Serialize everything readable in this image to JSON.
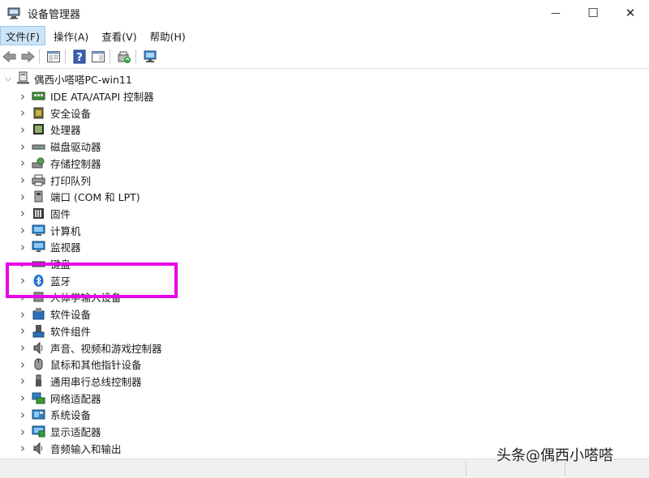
{
  "window": {
    "title": "设备管理器",
    "minimize_glyph": "—",
    "maximize_glyph": "☐",
    "close_glyph": "✕"
  },
  "menu": [
    {
      "label": "文件(F)",
      "active": true
    },
    {
      "label": "操作(A)",
      "active": false
    },
    {
      "label": "查看(V)",
      "active": false
    },
    {
      "label": "帮助(H)",
      "active": false
    }
  ],
  "toolbar": {
    "icons": [
      "back-arrow-icon",
      "forward-arrow-icon",
      "properties-sheet-icon",
      "help-icon",
      "show-hide-pane-icon",
      "update-driver-icon",
      "scan-hardware-icon"
    ]
  },
  "tree": {
    "root": {
      "label": "偶西小嗒嗒PC-win11",
      "expanded": true
    },
    "categories": [
      {
        "label": "IDE ATA/ATAPI 控制器",
        "icon": "ide-controller-icon"
      },
      {
        "label": "安全设备",
        "icon": "security-device-icon"
      },
      {
        "label": "处理器",
        "icon": "processor-icon"
      },
      {
        "label": "磁盘驱动器",
        "icon": "disk-drive-icon"
      },
      {
        "label": "存储控制器",
        "icon": "storage-controller-icon"
      },
      {
        "label": "打印队列",
        "icon": "print-queue-icon"
      },
      {
        "label": "端口 (COM 和 LPT)",
        "icon": "port-icon"
      },
      {
        "label": "固件",
        "icon": "firmware-icon"
      },
      {
        "label": "计算机",
        "icon": "computer-icon"
      },
      {
        "label": "监视器",
        "icon": "monitor-icon"
      },
      {
        "label": "键盘",
        "icon": "keyboard-icon"
      },
      {
        "label": "蓝牙",
        "icon": "bluetooth-icon"
      },
      {
        "label": "人体学输入设备",
        "icon": "hid-icon"
      },
      {
        "label": "软件设备",
        "icon": "software-device-icon"
      },
      {
        "label": "软件组件",
        "icon": "software-component-icon"
      },
      {
        "label": "声音、视频和游戏控制器",
        "icon": "sound-icon"
      },
      {
        "label": "鼠标和其他指针设备",
        "icon": "mouse-icon"
      },
      {
        "label": "通用串行总线控制器",
        "icon": "usb-icon"
      },
      {
        "label": "网络适配器",
        "icon": "network-adapter-icon"
      },
      {
        "label": "系统设备",
        "icon": "system-device-icon"
      },
      {
        "label": "显示适配器",
        "icon": "display-adapter-icon"
      },
      {
        "label": "音频输入和输出",
        "icon": "audio-io-icon"
      }
    ]
  },
  "highlight": {
    "target": "蓝牙",
    "color": "#e800e8"
  },
  "watermark": "头条@偶西小嗒嗒"
}
